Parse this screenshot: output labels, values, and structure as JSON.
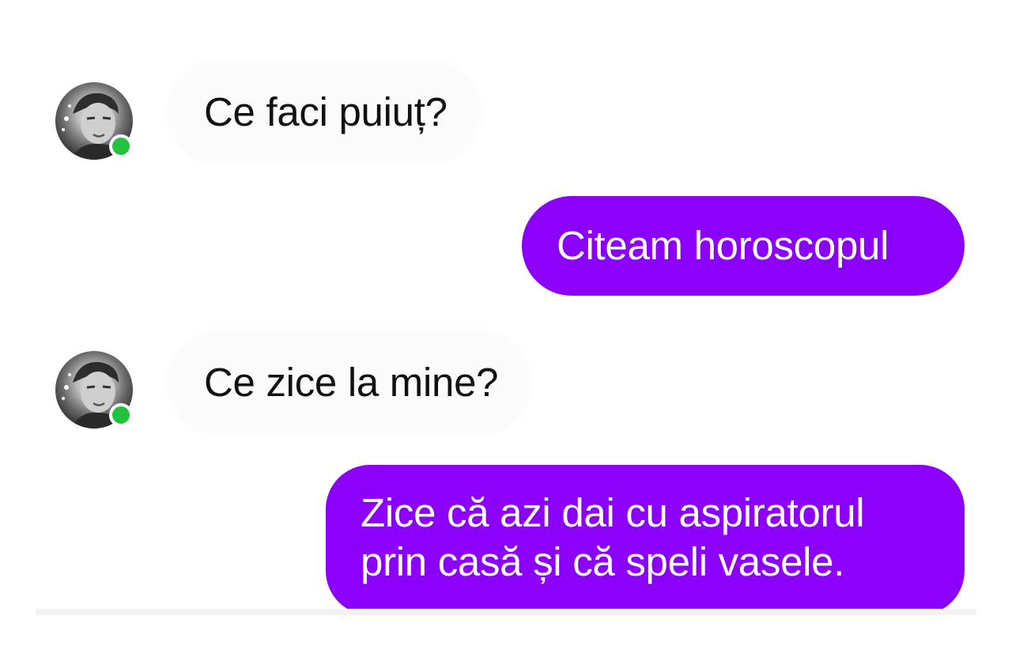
{
  "conversation": {
    "messages": [
      {
        "direction": "incoming",
        "avatar": "contact-avatar",
        "online": true,
        "text": "Ce faci puiuț?"
      },
      {
        "direction": "outgoing",
        "text": "Citeam horoscopul"
      },
      {
        "direction": "incoming",
        "avatar": "contact-avatar",
        "online": true,
        "text": "Ce zice la mine?"
      },
      {
        "direction": "outgoing",
        "lines": [
          "Zice că azi dai cu aspiratorul",
          "prin casă și că speli vasele."
        ]
      }
    ]
  },
  "colors": {
    "outgoing_bubble": "#8a00fb",
    "incoming_bubble": "#fbfbfb",
    "online_indicator": "#22c23f"
  },
  "icons": {
    "avatar": "contact-avatar-photo",
    "status": "online-status-dot"
  }
}
